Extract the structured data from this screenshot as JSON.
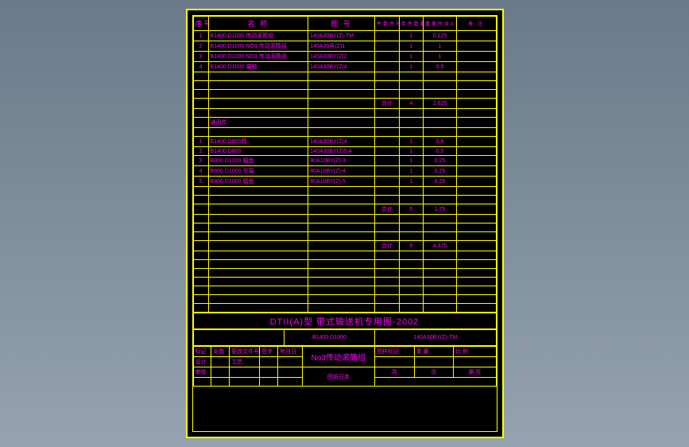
{
  "headers": {
    "seq": "序号",
    "name": "名 称",
    "drawing": "图 号",
    "code1": "件数件号",
    "code2": "单件数量",
    "wt": "重量所含A11",
    "remark": "备 注"
  },
  "rows1": [
    {
      "n": "1",
      "name": "B1400 D1000 传动滚筒组",
      "dwg": "140A30BY(Z)-TM",
      "c1": "",
      "c2": "1",
      "wt": "0.125",
      "rm": ""
    },
    {
      "n": "2",
      "name": "B1400 D1000 NO3 传动滚筒组",
      "dwg": "140A30号(Z)1",
      "c1": "",
      "c2": "1",
      "wt": "1",
      "rm": ""
    },
    {
      "n": "3",
      "name": "B1400 D1000 NO3 传动滚筒组",
      "dwg": "140A30BY(Z)2",
      "c1": "",
      "c2": "1",
      "wt": "1",
      "rm": ""
    },
    {
      "n": "4",
      "name": "B1400 D1000 端轴",
      "dwg": "140A30BY(Z)4",
      "c1": "",
      "c2": "1",
      "wt": "0.5",
      "rm": ""
    }
  ],
  "subtotal1": {
    "label": "合计",
    "c2": "4",
    "wt": "2.625"
  },
  "section2_label": "通用件",
  "rows2": [
    {
      "n": "1",
      "name": "B1400 D800筒",
      "dwg": "140A30BY(Z)4",
      "c1": "",
      "c2": "1",
      "wt": "0.5",
      "rm": ""
    },
    {
      "n": "2",
      "name": "B1400 D800",
      "dwg": "140A30BY(Z)5-4",
      "c1": "",
      "c2": "1",
      "wt": "0.5",
      "rm": ""
    },
    {
      "n": "3",
      "name": "B800 D1000 辐盘",
      "dwg": "80A10BY(Z)-3",
      "c1": "",
      "c2": "1",
      "wt": "0.25",
      "rm": ""
    },
    {
      "n": "4",
      "name": "B800 D1000 左端",
      "dwg": "80A10BY(Z)-4",
      "c1": "",
      "c2": "1",
      "wt": "0.25",
      "rm": ""
    },
    {
      "n": "5",
      "name": "B800 D1000 辐盘",
      "dwg": "80A10BY(Z)-5",
      "c1": "",
      "c2": "1",
      "wt": "0.25",
      "rm": ""
    }
  ],
  "subtotal2": {
    "label": "合计",
    "c2": "5",
    "wt": "1.75"
  },
  "subtotal3": {
    "label": "合计",
    "c2": "9",
    "wt": "4.375"
  },
  "title": "DTII(A)型 带式输送机专用图-2002",
  "spec": "B1400 D1000",
  "partno": "140A30BY(Z)-TM",
  "component": "No3传动滚筒组",
  "tb": {
    "h1": "标记",
    "h2": "处数",
    "h3": "更改文件号",
    "h4": "签字",
    "h5": "年月日",
    "r1": "设计",
    "r2": "审核",
    "r3": "工艺",
    "inst": "图样标记",
    "zl": "重 量",
    "bl": "比 例",
    "gong": "共",
    "ye": "页",
    "di": "第",
    "ye2": "页",
    "org": "图纸日本"
  }
}
